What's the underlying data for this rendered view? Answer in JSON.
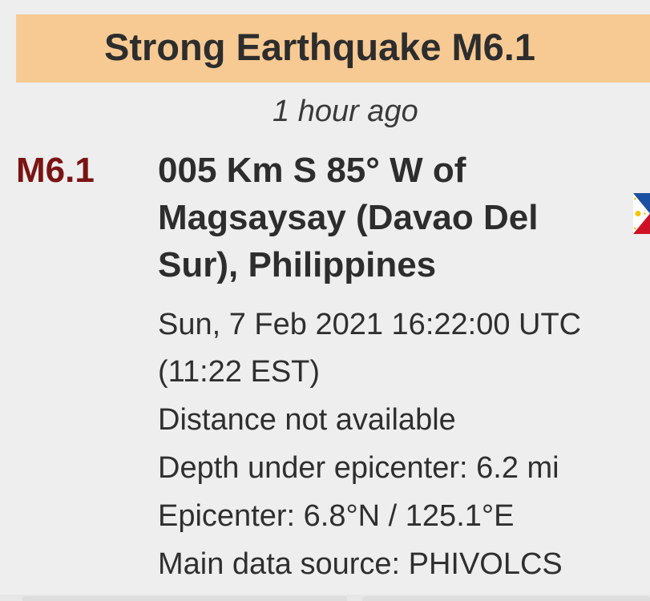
{
  "banner": {
    "title": "Strong Earthquake M6.1"
  },
  "event": {
    "time_ago": "1 hour ago",
    "magnitude": "M6.1",
    "location": "005 Km S 85° W of Magsaysay (Davao Del Sur), Philippines",
    "flag_icon": "philippines-flag-icon",
    "details": {
      "datetime": "Sun, 7 Feb 2021 16:22:00 UTC (11:22 EST)",
      "distance": "Distance not available",
      "depth": "Depth under epicenter: 6.2 mi",
      "epicenter": "Epicenter: 6.8°N / 125.1°E",
      "source": "Main data source: PHIVOLCS"
    }
  },
  "colors": {
    "banner_bg": "#f7ca93",
    "magnitude": "#7a1414",
    "text": "#2f2f2f",
    "background": "#eeeeee"
  }
}
